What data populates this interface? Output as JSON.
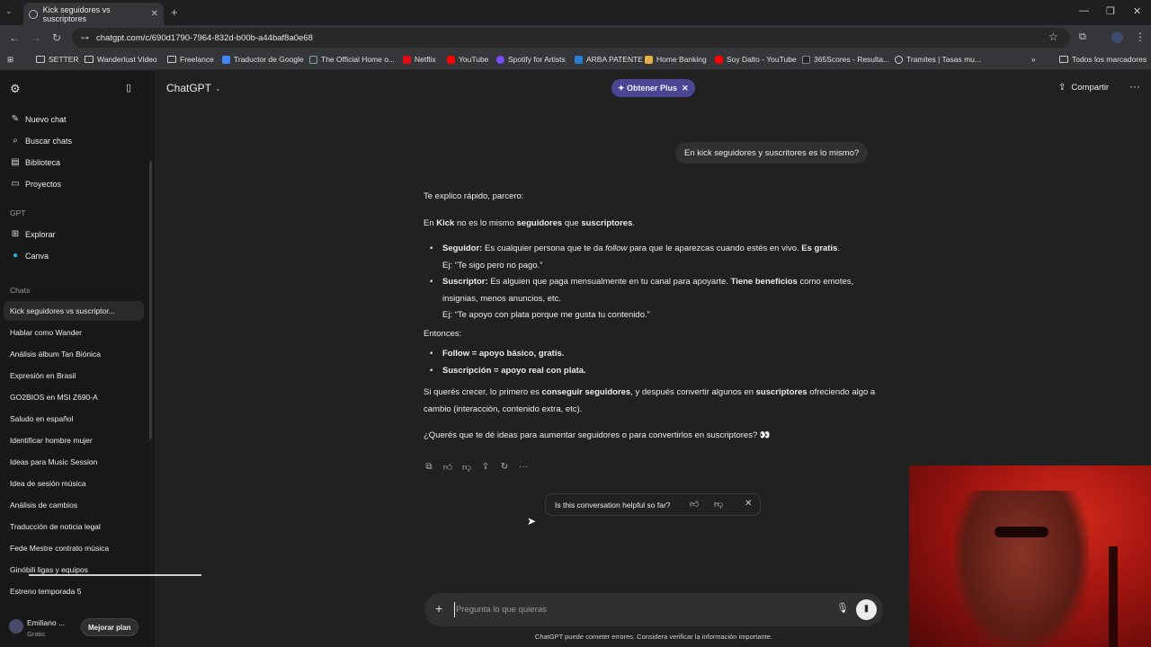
{
  "browser": {
    "tab_title": "Kick seguidores vs suscriptores",
    "url": "chatgpt.com/c/690d1790-7964-832d-b00b-a44baf8a0e68",
    "bookmarks": [
      "SETTER",
      "Wanderlust Video",
      "Freelance",
      "Traductor de Google",
      "The Official Home o...",
      "Netflix",
      "YouTube",
      "Spotify for Artists",
      "ARBA PATENTE",
      "Home Banking",
      "Soy Dalto - YouTube",
      "365Scores - Resulta...",
      "Tramites | Tasas mu..."
    ],
    "all_bookmarks": "Todos los marcadores"
  },
  "sidebar": {
    "nav": [
      {
        "label": "Nuevo chat",
        "icon": "edit-icon"
      },
      {
        "label": "Buscar chats",
        "icon": "search-icon"
      },
      {
        "label": "Biblioteca",
        "icon": "library-icon"
      },
      {
        "label": "Proyectos",
        "icon": "folder-icon"
      }
    ],
    "gpt_section": "GPT",
    "gpt_items": [
      {
        "label": "Explorar",
        "icon": "grid-icon"
      },
      {
        "label": "Canva",
        "icon": "canva-icon"
      }
    ],
    "chats_section": "Chats",
    "chats": [
      "Kick seguidores vs suscriptor...",
      "Hablar como Wander",
      "Análisis álbum Tan Biónica",
      "Expresión en Brasil",
      "GO2BIOS en MSI Z690-A",
      "Saludo en español",
      "Identificar hombre mujer",
      "Ideas para Music Session",
      "Idea de sesión música",
      "Análisis de cambios",
      "Traducción de noticia legal",
      "Fede Mestre contrato música",
      "Ginóbili ligas y equipos",
      "Estreno temporada 5"
    ],
    "user": {
      "name": "Emiliano ...",
      "plan": "Gratis",
      "upgrade": "Mejorar plan"
    }
  },
  "header": {
    "model": "ChatGPT",
    "plus_button": "Obtener Plus",
    "share": "Compartir"
  },
  "conversation": {
    "user_message": "En kick seguidores y suscritores es lo mismo?",
    "answer": {
      "intro": "Te explico rápido, parcero:",
      "p1_a": "En ",
      "p1_b": "Kick",
      "p1_c": " no es lo mismo ",
      "p1_d": "seguidores",
      "p1_e": " que ",
      "p1_f": "suscriptores",
      "p1_g": ".",
      "b1_title": "Seguidor:",
      "b1_text_a": " Es cualquier persona que te da ",
      "b1_text_em": "follow",
      "b1_text_b": " para que le aparezcas cuando estés en vivo. ",
      "b1_bold": "Es gratis",
      "b1_end": ".",
      "b1_ex": "Ej: “Te sigo pero no pago.”",
      "b2_title": "Suscriptor:",
      "b2_text": " Es alguien que paga mensualmente en tu canal para apoyarte. ",
      "b2_bold": "Tiene beneficios",
      "b2_text2": " como emotes, insignias, menos anuncios, etc.",
      "b2_ex": "Ej: “Te apoyo con plata porque me gusta tu contenido.”",
      "entonces": "Entonces:",
      "l1": "Follow = apoyo básico, gratis.",
      "l2": "Suscripción = apoyo real con plata.",
      "p2_a": "Si querés crecer, lo primero es ",
      "p2_b": "conseguir seguidores",
      "p2_c": ", y después convertir algunos en ",
      "p2_d": "suscriptores",
      "p2_e": " ofreciendo algo a cambio (interacción, contenido extra, etc).",
      "question": "¿Querés que te dé ideas para aumentar seguidores o para convertirlos en suscriptores? 👀"
    },
    "feedback_prompt": "Is this conversation helpful so far?"
  },
  "composer": {
    "placeholder": "Pregunta lo que quieras",
    "disclaimer": "ChatGPT puede cometer errores. Considera verificar la información importante."
  }
}
